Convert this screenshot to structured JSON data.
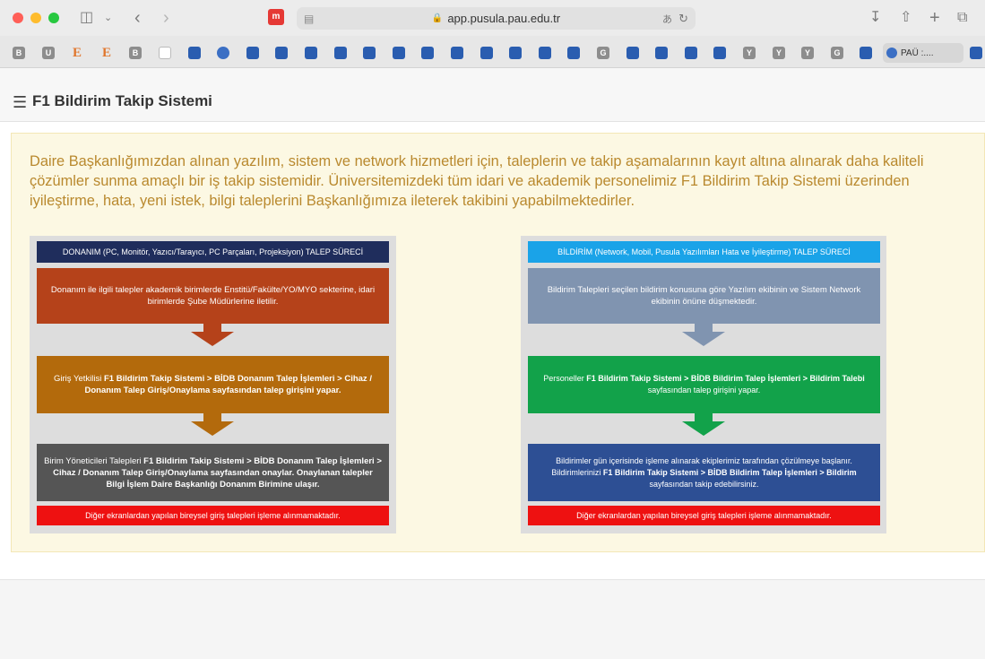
{
  "browser": {
    "url": "app.pusula.pau.edu.tr",
    "extension_label": "m",
    "bookmarks": [
      "B",
      "U",
      "E",
      "E",
      "B",
      "",
      "",
      "",
      "",
      "",
      "",
      "",
      "",
      "",
      "",
      "",
      "",
      "",
      "",
      "",
      "G",
      "",
      "",
      "",
      "",
      "Y",
      "Y",
      "Y",
      "G",
      ""
    ],
    "pau_bookmark": "PAÜ :....",
    "colors": {
      "close": "#ff5f57",
      "minimize": "#febc2e",
      "maximize": "#28c840"
    }
  },
  "header": {
    "title": "F1 Bildirim Takip Sistemi",
    "menu_icon": "hamburger-icon"
  },
  "notice": {
    "text": "Daire Başkanlığımızdan alınan yazılım, sistem ve network hizmetleri için, taleplerin ve takip aşamalarının kayıt altına alınarak daha kaliteli çözümler sunma amaçlı bir iş takip sistemidir. Üniversitemizdeki tüm idari ve akademik personelimiz F1 Bildirim Takip Sistemi üzerinden iyileştirme, hata, yeni istek, bilgi taleplerini Başkanlığımıza ileterek takibini yapabilmektedirler.",
    "color": "#b9892e"
  },
  "donanim": {
    "title": "DONANIM (PC, Monitör, Yazıcı/Tarayıcı, PC Parçaları, Projeksiyon) TALEP SÜRECİ",
    "step1": "Donanım ile ilgili talepler akademik birimlerde Enstitü/Fakülte/YO/MYO sekterine, idari birimlerde Şube Müdürlerine iletilir.",
    "step2_pre": "Giriş Yetkilisi ",
    "step2_bold": "F1 Bildirim Takip Sistemi > BİDB Donanım Talep İşlemleri > Cihaz / Donanım Talep Giriş/Onaylama sayfasından talep girişini yapar.",
    "step3_pre": "Birim Yöneticileri Talepleri ",
    "step3_bold": "F1 Bildirim Takip Sistemi > BİDB Donanım Talep İşlemleri > Cihaz / Donanım Talep Giriş/Onaylama sayfasından onaylar. Onaylanan talepler Bilgi İşlem Daire Başkanlığı Donanım Birimine ulaşır.",
    "footer": "Diğer ekranlardan yapılan bireysel giriş talepleri işleme alınmamaktadır.",
    "colors": {
      "title": "#1f2d5c",
      "step1": "#b5421a",
      "step2": "#b36a0c",
      "step3": "#555555",
      "footer": "#ee1111",
      "arrow1": "#b5421a",
      "arrow2": "#b36a0c"
    }
  },
  "bildirim": {
    "title": "BİLDİRİM (Network, Mobil, Pusula Yazılımları Hata ve İyileştirme) TALEP SÜRECİ",
    "step1": "Bildirim Talepleri seçilen bildirim konusuna göre Yazılım ekibinin ve Sistem Network ekibinin önüne düşmektedir.",
    "step2_pre": "Personeller ",
    "step2_bold": "F1 Bildirim Takip Sistemi > BİDB Bildirim Talep İşlemleri > Bildirim Talebi",
    "step2_post": " sayfasından talep girişini yapar.",
    "step3_pre": "Bildirimler gün içerisinde işleme alınarak ekiplerimiz tarafından çözülmeye başlanır. Bildirimlerinizi ",
    "step3_bold": "F1 Bildirim Takip Sistemi > BİDB Bildirim Talep İşlemleri > Bildirim",
    "step3_post": " sayfasından takip edebilirsiniz.",
    "footer": "Diğer ekranlardan yapılan bireysel giriş talepleri işleme alınmamaktadır.",
    "colors": {
      "title": "#1aa3e8",
      "step1": "#8094b0",
      "step2": "#12a24a",
      "step3": "#2d4f94",
      "footer": "#ee1111",
      "arrow1": "#8094b0",
      "arrow2": "#12a24a"
    }
  }
}
